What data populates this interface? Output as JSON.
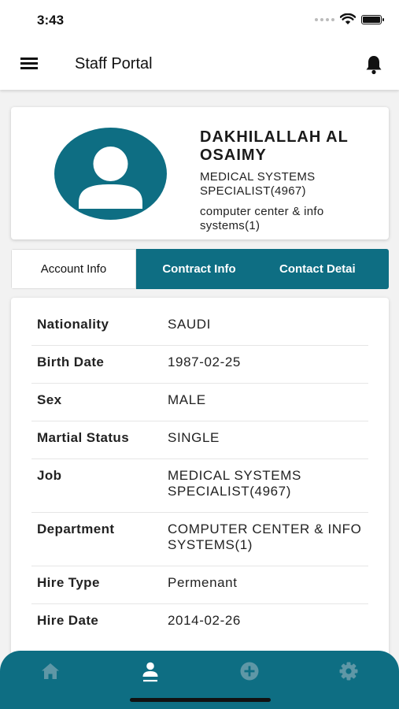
{
  "status_bar": {
    "time": "3:43"
  },
  "header": {
    "title": "Staff Portal",
    "menu_icon": "menu-icon",
    "notification_icon": "bell-icon"
  },
  "profile": {
    "name": "DAKHILALLAH AL OSAIMY",
    "job": "MEDICAL SYSTEMS SPECIALIST(4967)",
    "department": "computer center & info systems(1)",
    "avatar_icon": "person-icon"
  },
  "tabs": [
    {
      "label": "Account Info",
      "active": true
    },
    {
      "label": "Contract Info",
      "active": false
    },
    {
      "label": "Contact Detai",
      "active": false
    }
  ],
  "account_info": [
    {
      "label": "Nationality",
      "value": "SAUDI"
    },
    {
      "label": "Birth Date",
      "value": "1987-02-25"
    },
    {
      "label": "Sex",
      "value": "MALE"
    },
    {
      "label": "Martial Status",
      "value": "SINGLE"
    },
    {
      "label": "Job",
      "value": "MEDICAL SYSTEMS SPECIALIST(4967)"
    },
    {
      "label": "Department",
      "value": "COMPUTER CENTER & INFO SYSTEMS(1)"
    },
    {
      "label": "Hire Type",
      "value": "Permenant"
    },
    {
      "label": "Hire Date",
      "value": "2014-02-26"
    }
  ],
  "bottom_nav": [
    {
      "icon": "home-icon",
      "active": false
    },
    {
      "icon": "profile-icon",
      "active": true
    },
    {
      "icon": "add-circle-icon",
      "active": false
    },
    {
      "icon": "settings-icon",
      "active": false
    }
  ],
  "colors": {
    "primary": "#0e6e83",
    "active_nav": "#ffffff",
    "inactive_nav": "#5f97a6"
  }
}
